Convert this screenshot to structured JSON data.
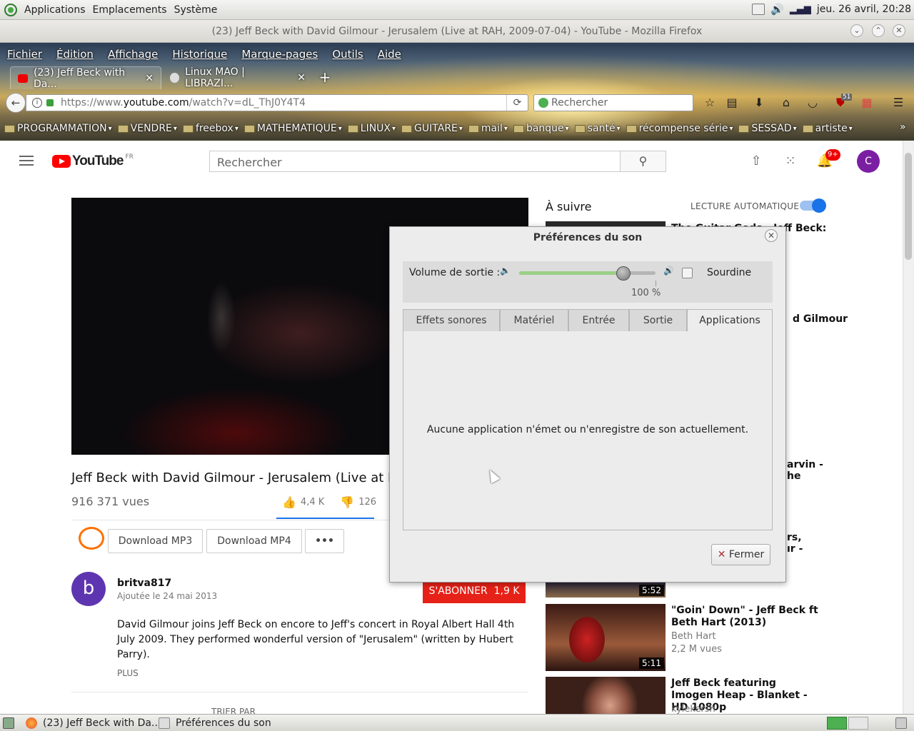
{
  "top_panel": {
    "menus": [
      "Applications",
      "Emplacements",
      "Système"
    ],
    "clock": "jeu. 26 avril, 20:28"
  },
  "firefox": {
    "window_title": "(23) Jeff Beck with David Gilmour - Jerusalem (Live at RAH, 2009-07-04) - YouTube - Mozilla Firefox",
    "menubar": [
      "Fichier",
      "Édition",
      "Affichage",
      "Historique",
      "Marque-pages",
      "Outils",
      "Aide"
    ],
    "tabs": [
      {
        "label": "(23) Jeff Beck with Da...",
        "active": true
      },
      {
        "label": "Linux MAO | LIBRAZI...",
        "active": false
      }
    ],
    "new_tab": "+",
    "url_prefix": "https://www.",
    "url_domain": "youtube.com",
    "url_path": "/watch?v=dL_ThJ0Y4T4",
    "search_placeholder": "Rechercher",
    "ublock_count": "51",
    "bookmarks": [
      "PROGRAMMATION",
      "VENDRE",
      "freebox",
      "MATHEMATIQUE",
      "LINUX",
      "GUITARE",
      "mail",
      "banque",
      "santé",
      "récompense série",
      "SESSAD",
      "artiste"
    ],
    "overflow": "»"
  },
  "youtube": {
    "logo_text": "YouTube",
    "logo_region": "FR",
    "search_placeholder": "Rechercher",
    "notif_count": "9+",
    "avatar_letter": "C",
    "video_title": "Jeff Beck with David Gilmour - Jerusalem (Live at RAH, 2",
    "views": "916 371 vues",
    "likes": "4,4 K",
    "dislikes": "126",
    "like_ratio": 0.97,
    "download_mp3": "Download MP3",
    "download_mp4": "Download MP4",
    "more": "•••",
    "channel_avatar": "b",
    "channel_name": "britva817",
    "upload_date": "Ajoutée le 24 mai 2013",
    "subscribe": "S'ABONNER",
    "subscribers": "1,9 K",
    "description": "David Gilmour joins Jeff Beck on encore to Jeff's concert in Royal Albert Hall 4th July 2009. They performed wonderful version of \"Jerusalem\" (written by Hubert Parry).",
    "show_more": "PLUS",
    "sort_label": "TRIER PAR",
    "up_next": "À suivre",
    "autoplay": "LECTURE AUTOMATIQUE",
    "sidebar": {
      "item1_title": "The Guitar Gods - Jeff Beck:",
      "item2_title_frag": "d Gilmour",
      "item3_frag1": "arvin -",
      "item3_frag2": "he",
      "item4_frag1": "rs,",
      "item4_frag2": "ır -",
      "item4_dur": "5:52",
      "item5_title": "\"Goin' Down\" - Jeff Beck ft Beth Hart (2013)",
      "item5_channel": "Beth Hart",
      "item5_views": "2,2 M vues",
      "item5_dur": "5:11",
      "item6_title": "Jeff Beck featuring Imogen Heap - Blanket - HD 1080p",
      "item6_channel": "kylekersh"
    }
  },
  "sound_dialog": {
    "title": "Préférences du son",
    "volume_label": "Volume de sortie :",
    "volume_value": 100,
    "volume_pct": "100 %",
    "mute_label": "Sourdine",
    "mute_checked": false,
    "tabs": [
      "Effets sonores",
      "Matériel",
      "Entrée",
      "Sortie",
      "Applications"
    ],
    "selected_tab": "Applications",
    "empty_message": "Aucune application n'émet ou n'enregistre de son actuellement.",
    "close_button": "Fermer"
  },
  "taskbar": {
    "items": [
      "(23) Jeff Beck with Da...",
      "Préférences du son"
    ]
  }
}
